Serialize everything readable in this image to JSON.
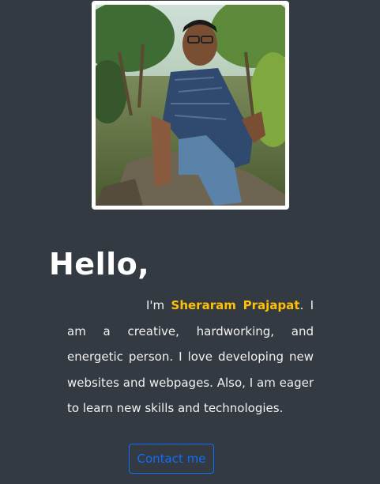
{
  "hero": {
    "greeting": "Hello,",
    "intro_prefix": "I'm ",
    "name": "Sheraram Prajapat",
    "intro_rest": ". I am a creative, hardworking, and energetic person. I love developing new websites and webpages. Also, I am eager to learn new skills and technologies.",
    "contact_button": "Contact me",
    "accent_color": "#ffc107",
    "button_color": "#0d6efd"
  }
}
